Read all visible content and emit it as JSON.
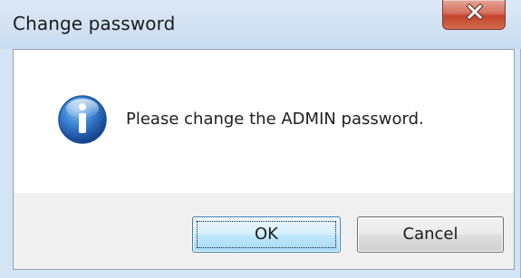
{
  "window": {
    "title": "Change password",
    "close_icon": "close-icon"
  },
  "dialog": {
    "icon": "info-icon",
    "message": "Please change the ADMIN password."
  },
  "buttons": {
    "ok_label": "OK",
    "cancel_label": "Cancel"
  },
  "colors": {
    "titlebar": "#d3e4f5",
    "close_button": "#c3452c",
    "info_icon": "#2a6cbf",
    "ok_button_border": "#3c7fb1"
  }
}
